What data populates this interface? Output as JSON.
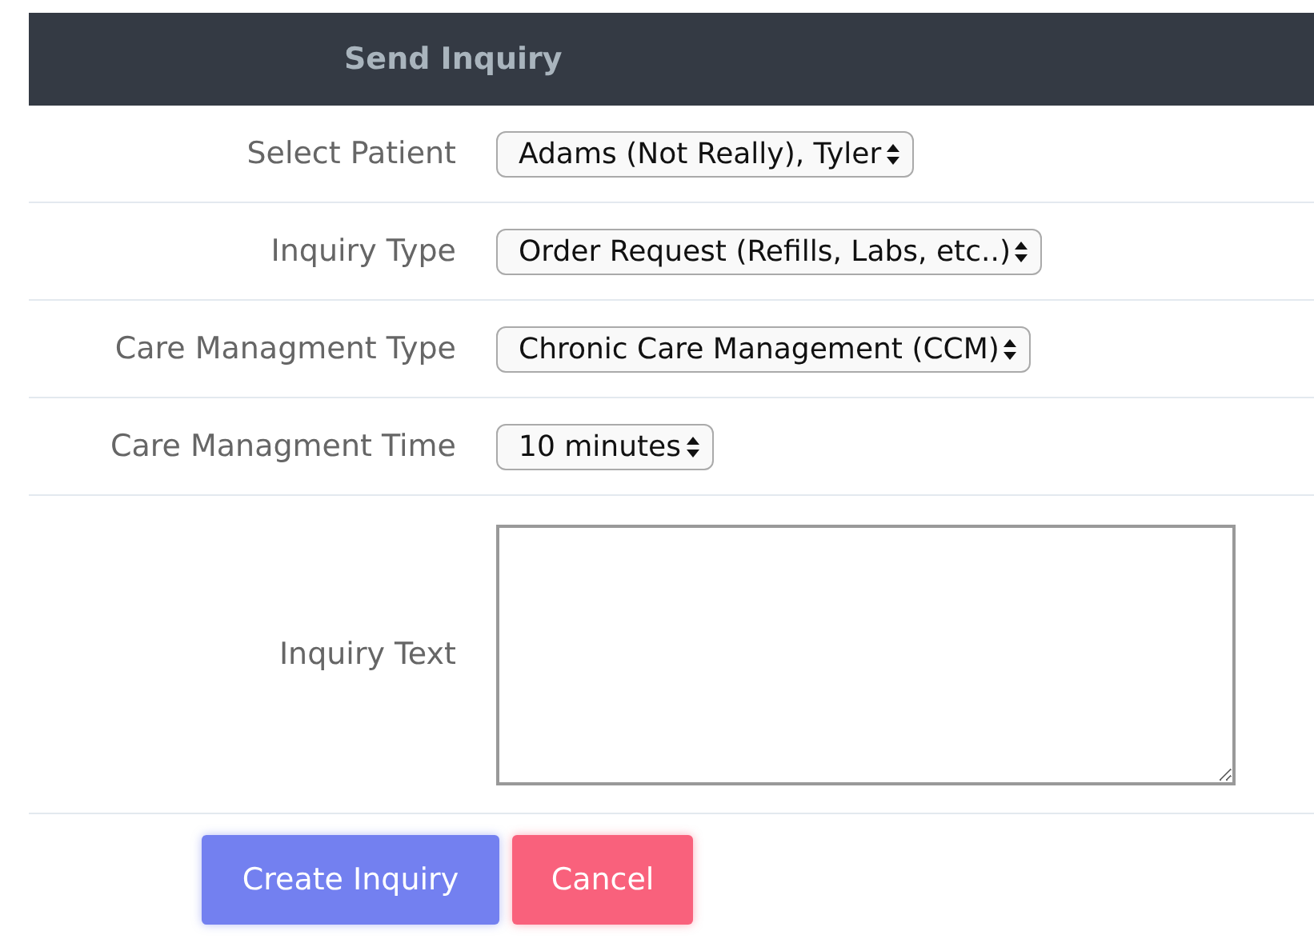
{
  "header": {
    "title": "Send Inquiry"
  },
  "fields": [
    {
      "kind": "select",
      "label": "Select Patient",
      "value": "Adams (Not Really), Tyler"
    },
    {
      "kind": "select",
      "label": "Inquiry Type",
      "value": "Order Request (Refills, Labs, etc..)"
    },
    {
      "kind": "select",
      "label": "Care Managment Type",
      "value": "Chronic Care Management (CCM)"
    },
    {
      "kind": "select",
      "label": "Care Managment Time",
      "value": "10 minutes"
    },
    {
      "kind": "textarea",
      "label": "Inquiry Text"
    }
  ],
  "buttons": [
    {
      "kind": "primary",
      "label": "Create Inquiry"
    },
    {
      "kind": "danger",
      "label": "Cancel"
    }
  ]
}
